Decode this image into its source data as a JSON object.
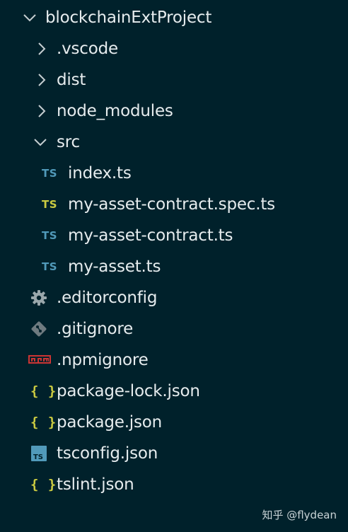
{
  "explorer": {
    "root": {
      "label": "blockchainExtProject",
      "expanded": true,
      "twisty_icon": "chevron-down-icon"
    },
    "items": [
      {
        "label": ".vscode",
        "type": "folder",
        "expanded": false,
        "icon": "chevron-right-icon"
      },
      {
        "label": "dist",
        "type": "folder",
        "expanded": false,
        "icon": "chevron-right-icon"
      },
      {
        "label": "node_modules",
        "type": "folder",
        "expanded": false,
        "icon": "chevron-right-icon"
      },
      {
        "label": "src",
        "type": "folder",
        "expanded": true,
        "icon": "chevron-down-icon"
      },
      {
        "label": "index.ts",
        "type": "file",
        "icon": "typescript-icon",
        "icon_text": "TS",
        "icon_color": "#519aba"
      },
      {
        "label": "my-asset-contract.spec.ts",
        "type": "file",
        "icon": "typescript-test-icon",
        "icon_text": "TS",
        "icon_color": "#cbcb41"
      },
      {
        "label": "my-asset-contract.ts",
        "type": "file",
        "icon": "typescript-icon",
        "icon_text": "TS",
        "icon_color": "#519aba"
      },
      {
        "label": "my-asset.ts",
        "type": "file",
        "icon": "typescript-icon",
        "icon_text": "TS",
        "icon_color": "#519aba"
      },
      {
        "label": ".editorconfig",
        "type": "file",
        "icon": "gear-icon",
        "icon_color": "#9aa7ab"
      },
      {
        "label": ".gitignore",
        "type": "file",
        "icon": "git-icon",
        "icon_color": "#6f7b80"
      },
      {
        "label": ".npmignore",
        "type": "file",
        "icon": "npm-icon",
        "icon_text": "npm",
        "icon_color": "#cc3534"
      },
      {
        "label": "package-lock.json",
        "type": "file",
        "icon": "json-icon",
        "icon_text": "{ }",
        "icon_color": "#cbcb41"
      },
      {
        "label": "package.json",
        "type": "file",
        "icon": "json-icon",
        "icon_text": "{ }",
        "icon_color": "#cbcb41"
      },
      {
        "label": "tsconfig.json",
        "type": "file",
        "icon": "tsconfig-icon",
        "icon_text": "TS",
        "icon_color": "#519aba"
      },
      {
        "label": "tslint.json",
        "type": "file",
        "icon": "json-icon",
        "icon_text": "{ }",
        "icon_color": "#cbcb41"
      }
    ]
  },
  "watermark": {
    "text": "知乎 @flydean"
  },
  "colors": {
    "background": "#00212b",
    "text": "#e6ecee",
    "chevron": "#c5ced1",
    "ts_blue": "#519aba",
    "ts_yellow": "#cbcb41",
    "npm_red": "#cc3534"
  }
}
